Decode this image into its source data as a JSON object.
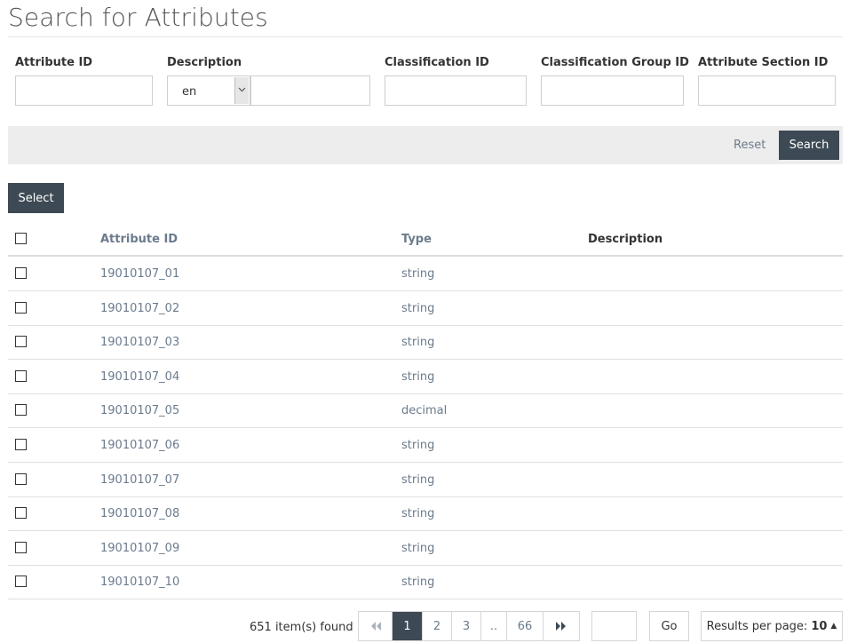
{
  "page": {
    "title": "Search for Attributes"
  },
  "filters": {
    "attribute_id": {
      "label": "Attribute ID",
      "value": ""
    },
    "description": {
      "label": "Description",
      "language": "en",
      "value": ""
    },
    "classification_id": {
      "label": "Classification ID",
      "value": ""
    },
    "classification_group_id": {
      "label": "Classification Group ID",
      "value": ""
    },
    "attribute_section_id": {
      "label": "Attribute Section ID",
      "value": ""
    }
  },
  "actions": {
    "reset_label": "Reset",
    "search_label": "Search",
    "select_label": "Select"
  },
  "table": {
    "columns": {
      "id": "Attribute ID",
      "type": "Type",
      "description": "Description"
    },
    "rows": [
      {
        "id": "19010107_01",
        "type": "string",
        "description": ""
      },
      {
        "id": "19010107_02",
        "type": "string",
        "description": ""
      },
      {
        "id": "19010107_03",
        "type": "string",
        "description": ""
      },
      {
        "id": "19010107_04",
        "type": "string",
        "description": ""
      },
      {
        "id": "19010107_05",
        "type": "decimal",
        "description": ""
      },
      {
        "id": "19010107_06",
        "type": "string",
        "description": ""
      },
      {
        "id": "19010107_07",
        "type": "string",
        "description": ""
      },
      {
        "id": "19010107_08",
        "type": "string",
        "description": ""
      },
      {
        "id": "19010107_09",
        "type": "string",
        "description": ""
      },
      {
        "id": "19010107_10",
        "type": "string",
        "description": ""
      }
    ]
  },
  "pagination": {
    "found_text": "651 item(s) found",
    "pages": [
      "1",
      "2",
      "3",
      "..",
      "66"
    ],
    "current_page": "1",
    "goto_value": "",
    "go_label": "Go",
    "results_per_page_label": "Results per page:",
    "results_per_page_value": "10"
  },
  "colors": {
    "dark_button": "#3d4a55",
    "link": "#6b7b8c",
    "bar": "#ededed"
  }
}
